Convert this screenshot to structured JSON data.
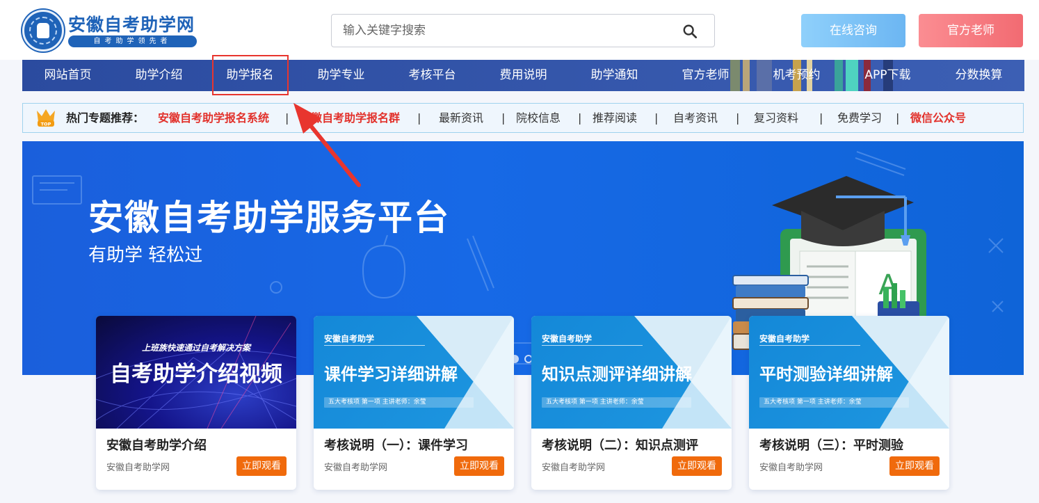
{
  "colors": {
    "brand_blue": "#1f63b8",
    "nav_bg": "#2b4b9f",
    "banner_blue": "#1769e6",
    "accent_red": "#e2312b",
    "watch_orange": "#f06a0c",
    "online_btn": "#7cc3f7",
    "teacher_btn": "#f77c82"
  },
  "header": {
    "logo_title": "安徽自考助学网",
    "logo_slogan": "自考助学领先者",
    "search_placeholder": "输入关键字搜索",
    "search_icon": "search-icon",
    "online_consult": "在线咨询",
    "official_teacher": "官方老师"
  },
  "nav": {
    "items": [
      {
        "label": "网站首页"
      },
      {
        "label": "助学介绍"
      },
      {
        "label": "助学报名"
      },
      {
        "label": "助学专业"
      },
      {
        "label": "考核平台"
      },
      {
        "label": "费用说明"
      },
      {
        "label": "助学通知"
      },
      {
        "label": "官方老师"
      },
      {
        "label": "机考预约"
      },
      {
        "label": "APP下载"
      },
      {
        "label": "分数换算"
      }
    ],
    "highlighted": "助学报名"
  },
  "hot": {
    "icon": "crown-top-icon",
    "label": "热门专题推荐：",
    "links": [
      {
        "label": "安徽自考助学报名系统"
      },
      {
        "label": "安徽自考助学报名群"
      },
      {
        "label": "最新资讯"
      },
      {
        "label": "院校信息"
      },
      {
        "label": "推荐阅读"
      },
      {
        "label": "自考资讯"
      },
      {
        "label": "复习资料"
      },
      {
        "label": "免费学习"
      },
      {
        "label": "微信公众号"
      }
    ]
  },
  "banner": {
    "title": "安徽自考助学服务平台",
    "subtitle": "有助学  轻松过",
    "carousel_active": 1,
    "carousel_count": 2
  },
  "cards": [
    {
      "thumb_tag": "上班族快速通过自考解决方案",
      "thumb_title": "自考助学介绍视频",
      "title": "安徽自考助学介绍",
      "source": "安徽自考助学网",
      "button": "立即观看"
    },
    {
      "thumb_tag": "安徽自考助学",
      "thumb_title": "课件学习详细讲解",
      "thumb_strip": "五大考核项   第一项    主讲老师：余莹",
      "title": "考核说明（一）：课件学习",
      "source": "安徽自考助学网",
      "button": "立即观看"
    },
    {
      "thumb_tag": "安徽自考助学",
      "thumb_title": "知识点测评详细讲解",
      "thumb_strip": "五大考核项   第一项    主讲老师：余莹",
      "title": "考核说明（二）：知识点测评",
      "source": "安徽自考助学网",
      "button": "立即观看"
    },
    {
      "thumb_tag": "安徽自考助学",
      "thumb_title": "平时测验详细讲解",
      "thumb_strip": "五大考核项   第一项    主讲老师：余莹",
      "title": "考核说明（三）：平时测验",
      "source": "安徽自考助学网",
      "button": "立即观看"
    }
  ]
}
